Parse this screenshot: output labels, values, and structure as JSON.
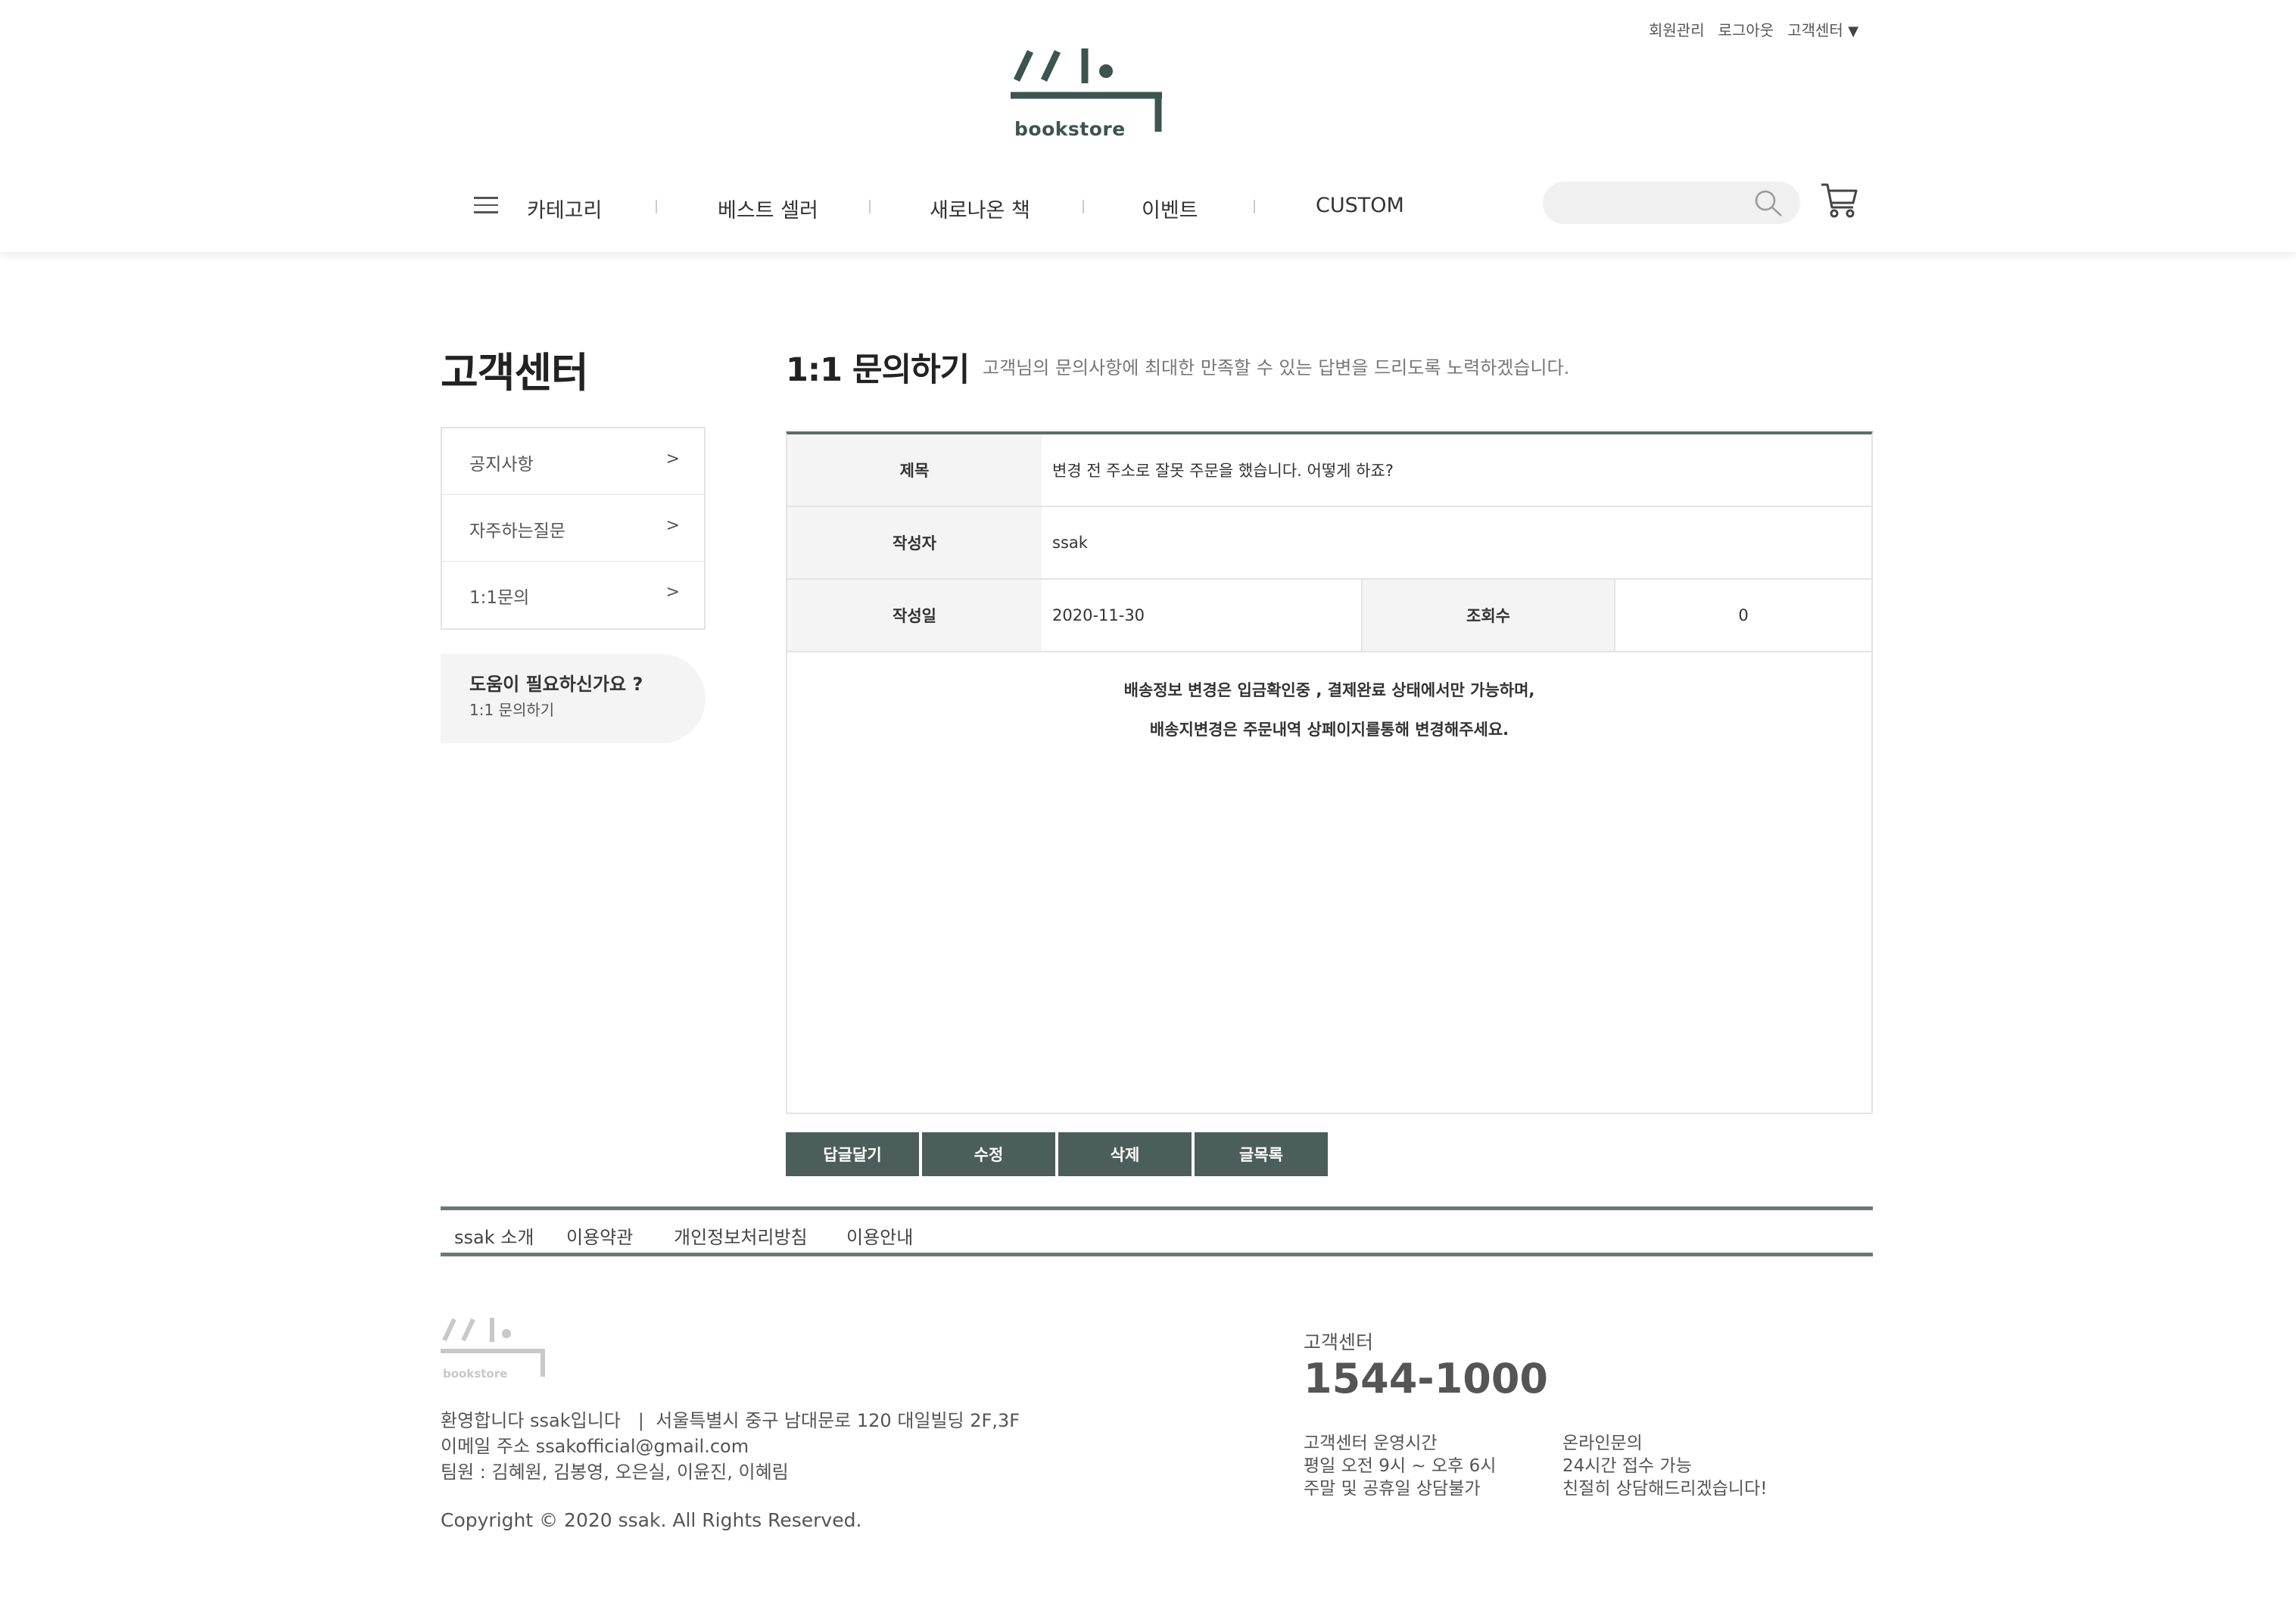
{
  "header": {
    "util_links": [
      "회원관리",
      "로그아웃",
      "고객센터"
    ],
    "util_dropdown": "▼",
    "logo_text": "bookstore",
    "nav": [
      "카테고리",
      "베스트 셀러",
      "새로나온 책",
      "이벤트",
      "CUSTOM"
    ],
    "search_placeholder": ""
  },
  "sidebar": {
    "title": "고객센터",
    "items": [
      {
        "label": "공지사항",
        "arrow": ">"
      },
      {
        "label": "자주하는질문",
        "arrow": ">"
      },
      {
        "label": "1:1문의",
        "arrow": ">"
      }
    ],
    "help_title": "도움이 필요하신가요 ?",
    "help_link": "1:1 문의하기"
  },
  "main": {
    "title": "1:1 문의하기",
    "description": "고객님의 문의사항에 최대한 만족할 수 있는 답변을 드리도록 노력하겠습니다.",
    "board": {
      "subject_label": "제목",
      "subject_value": "변경 전 주소로 잘못 주문을 했습니다. 어떻게 하죠?",
      "writer_label": "작성자",
      "writer_value": "ssak",
      "date_label": "작성일",
      "date_value": "2020-11-30",
      "views_label": "조회수",
      "views_value": "0",
      "content_line1": "배송정보 변경은 입금확인중 , 결제완료 상태에서만 가능하며,",
      "content_line2": "배송지변경은 주문내역 상페이지를통해 변경해주세요."
    },
    "buttons": [
      "답글달기",
      "수정",
      "삭제",
      "글목록"
    ]
  },
  "footer": {
    "nav": [
      "ssak 소개",
      "이용약관",
      "개인정보처리방침",
      "이용안내"
    ],
    "logo_text": "bookstore",
    "info_line1": "환영합니다 ssak입니다   |  서울특별시 중구 남대문로 120 대일빌딩 2F,3F",
    "info_line2": "이메일 주소 ssakofficial@gmail.com",
    "info_line3": "팀원 : 김혜원, 김봉영, 오은실, 이윤진, 이혜림",
    "copyright": "Copyright © 2020 ssak. All Rights Reserved.",
    "cs_label": "고객센터",
    "cs_phone": "1544-1000",
    "hours_title": "고객센터 운영시간",
    "hours_line1": "평일 오전 9시 ~ 오후 6시",
    "hours_line2": "주말 및 공휴일 상담불가",
    "online_title": "온라인문의",
    "online_line1": "24시간 접수 가능",
    "online_line2": "친절히 상담해드리겠습니다!"
  },
  "colors": {
    "brand": "#4b5e5b",
    "border_dark": "#6a7876",
    "table_head_bg": "#f4f4f4"
  }
}
